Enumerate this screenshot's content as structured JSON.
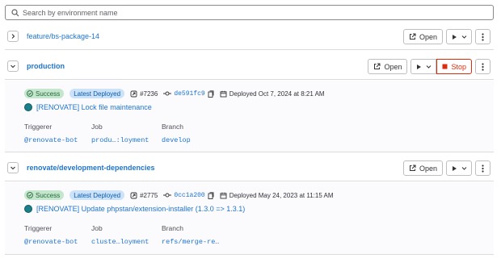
{
  "search": {
    "placeholder": "Search by environment name"
  },
  "environments": [
    {
      "name": "feature/bs-package-14",
      "open_label": "Open"
    },
    {
      "name": "production",
      "open_label": "Open",
      "stop_label": "Stop",
      "status": "Success",
      "latest_label": "Latest Deployed",
      "deploy_id": "#7236",
      "sha": "de591fc9",
      "deployed_at": "Deployed Oct 7, 2024 at 8:21 AM",
      "commit_title": "[RENOVATE] Lock file maintenance",
      "triggerer_label": "Triggerer",
      "triggerer": "@renovate-bot",
      "job_label": "Job",
      "job": "produ…:loyment",
      "branch_label": "Branch",
      "branch": "develop"
    },
    {
      "name": "renovate/development-dependencies",
      "open_label": "Open",
      "status": "Success",
      "latest_label": "Latest Deployed",
      "deploy_id": "#2775",
      "sha": "0cc1a200",
      "deployed_at": "Deployed May 24, 2023 at 11:15 AM",
      "commit_title": "[RENOVATE] Update phpstan/extension-installer (1.3.0 => 1.3.1)",
      "triggerer_label": "Triggerer",
      "triggerer": "@renovate-bot",
      "job_label": "Job",
      "job": "cluste…loyment",
      "branch_label": "Branch",
      "branch": "refs/merge-re…"
    }
  ],
  "colors": {
    "link": "#1f75cb",
    "danger": "#dd2b0e",
    "success_bg": "#c3e6cd",
    "info_bg": "#cbe2f9"
  }
}
